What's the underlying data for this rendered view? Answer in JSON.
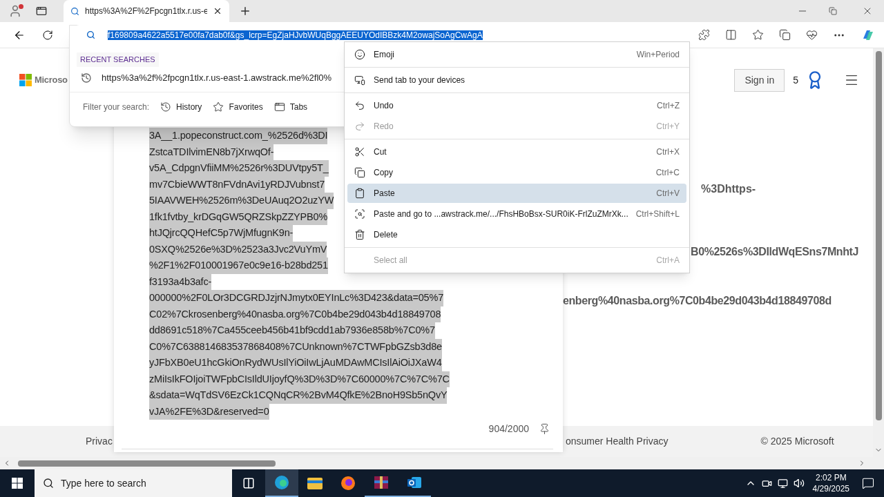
{
  "browser": {
    "tabs": [
      {
        "title": "https%3A%2F%2Fpcgn1tlx.r.us-e",
        "selected": true
      }
    ],
    "address": {
      "value": "f169809a4622a5517e00fa7dab0f&gs_lcrp=EgZjaHJvbWUqBggAEEUYOdIBBzk4M2owajSoAgCwAgA",
      "selected": true
    }
  },
  "suggestions": {
    "heading": "RECENT SEARCHES",
    "items": [
      "https%3a%2f%2fpcgn1tlx.r.us-east-1.awstrack.me%2fl0%"
    ],
    "filter_label": "Filter your search:",
    "filters": [
      "History",
      "Favorites",
      "Tabs"
    ]
  },
  "page": {
    "brand": "Microso",
    "sign_in": "Sign in",
    "points": "5",
    "background_lines": [
      "%3Dhttps-",
      "B0%2526s%3DIldWqESns7MnhtJ",
      "enberg%40nasba.org%7C0b4be29d043b4d18849708d"
    ],
    "footer": [
      "Privac",
      "onsumer Health Privacy",
      "© 2025 Microsoft"
    ]
  },
  "text_box": {
    "selected": true,
    "lines": [
      "3A__1.popeconstruct.com_%2526d%3DI",
      "ZstcaTDIlvimEN8b7jXrwqOf-",
      "v5A_CdpgnVfiiMM%2526r%3DUVtpy5T_",
      "mv7CbieWWT8nFVdnAvi1yRDJVubnst7",
      "5IAAVWEH%2526m%3DeUAuq2O2uzYW",
      "1fk1fvtby_krDGqGW5QRZSkpZZYPB0%",
      "htJQjrcQQHefC5p7WjMfugnK9n-",
      "0SXQ%2526e%3D%2523a3Jvc2VuYmV",
      "%2F1%2F010001967e0c9e16-b28bd251",
      "f3193a4b3afc-",
      "000000%2F0LOr3DCGRDJzjrNJmytx0EYInLc%3D423&data=05%7",
      "C02%7Ckrosenberg%40nasba.org%7C0b4be29d043b4d18849708",
      "dd8691c518%7Ca455ceeb456b41bf9cdd1ab7936e858b%7C0%7",
      "C0%7C638814683537868408%7CUnknown%7CTWFpbGZsb3d8e",
      "yJFbXB0eU1hcGkiOnRydWUsIlYiOiIwLjAuMDAwMCIsIlAiOiJXaW4",
      "zMiIsIkFOIjoiTWFpbCIsIldUIjoyfQ%3D%3D%7C60000%7C%7C%7C",
      "&sdata=WqTdSV6EzCk1CQNqCR%2BvM4QfkE%2BnoH9Sb5nQvY",
      "vJA%2FE%3D&reserved=0"
    ],
    "count": "904/2000"
  },
  "context_menu": [
    {
      "kind": "item",
      "label": "Emoji",
      "shortcut": "Win+Period",
      "disabled": false,
      "selected": false
    },
    {
      "kind": "separator"
    },
    {
      "kind": "item",
      "label": "Send tab to your devices",
      "disabled": false,
      "selected": false
    },
    {
      "kind": "separator"
    },
    {
      "kind": "item",
      "label": "Undo",
      "shortcut": "Ctrl+Z",
      "disabled": false,
      "selected": false
    },
    {
      "kind": "item",
      "label": "Redo",
      "shortcut": "Ctrl+Y",
      "disabled": true,
      "selected": false
    },
    {
      "kind": "separator"
    },
    {
      "kind": "item",
      "label": "Cut",
      "shortcut": "Ctrl+X",
      "disabled": false,
      "selected": false
    },
    {
      "kind": "item",
      "label": "Copy",
      "shortcut": "Ctrl+C",
      "disabled": false,
      "selected": false
    },
    {
      "kind": "item",
      "label": "Paste",
      "shortcut": "Ctrl+V",
      "disabled": false,
      "selected": true
    },
    {
      "kind": "item",
      "label": "Paste and go to ...awstrack.me/.../FhsHBoBsx-SUR0iK-FrlZuZMrXk...",
      "shortcut": "Ctrl+Shift+L",
      "disabled": false,
      "selected": false
    },
    {
      "kind": "item",
      "label": "Delete",
      "disabled": false,
      "selected": false
    },
    {
      "kind": "separator"
    },
    {
      "kind": "item",
      "label": "Select all",
      "shortcut": "Ctrl+A",
      "disabled": true,
      "selected": false
    }
  ],
  "taskbar": {
    "search_placeholder": "Type here to search",
    "time": "2:02 PM",
    "date": "4/29/2025"
  }
}
